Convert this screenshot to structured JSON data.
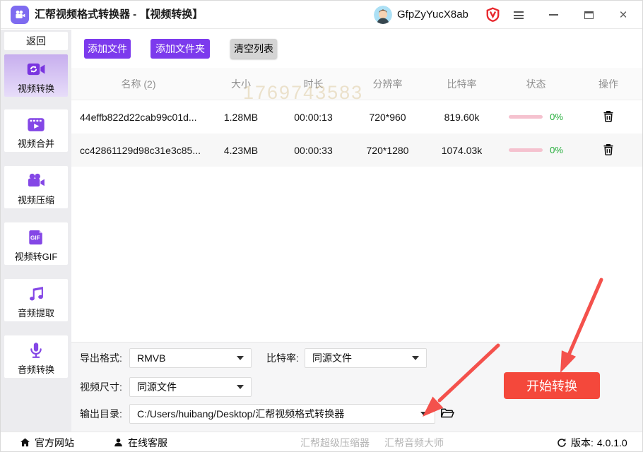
{
  "colors": {
    "accent_purple": "#7c3aed",
    "danger_red": "#f4483b",
    "annotation_red": "#f4514c",
    "progress_pink": "#f5c2cf",
    "success_green": "#22ac38"
  },
  "title_bar": {
    "app_title": "汇帮视频格式转换器 - 【视频转换】",
    "username": "GfpZyYucX8ab"
  },
  "sidebar": {
    "back": "返回",
    "items": [
      {
        "label": "视频转换",
        "icon": "video-convert-icon",
        "active": true
      },
      {
        "label": "视频合并",
        "icon": "video-merge-icon",
        "active": false
      },
      {
        "label": "视频压缩",
        "icon": "video-compress-icon",
        "active": false
      },
      {
        "label": "视频转GIF",
        "icon": "video-to-gif-icon",
        "active": false
      },
      {
        "label": "音频提取",
        "icon": "audio-extract-icon",
        "active": false
      },
      {
        "label": "音频转换",
        "icon": "audio-convert-icon",
        "active": false
      }
    ]
  },
  "toolbar": {
    "add_file": "添加文件",
    "add_folder": "添加文件夹",
    "clear_list": "清空列表"
  },
  "table": {
    "headers": [
      "名称 (2)",
      "大小",
      "时长",
      "分辨率",
      "比特率",
      "状态",
      "操作"
    ],
    "watermark": "1769743583",
    "rows": [
      {
        "name": "44effb822d22cab99c01d...",
        "size": "1.28MB",
        "duration": "00:00:13",
        "resolution": "720*960",
        "bitrate": "819.60k",
        "progress": "0%"
      },
      {
        "name": "cc42861129d98c31e3c85...",
        "size": "4.23MB",
        "duration": "00:00:33",
        "resolution": "720*1280",
        "bitrate": "1074.03k",
        "progress": "0%"
      }
    ]
  },
  "settings": {
    "export_format": {
      "label": "导出格式:",
      "value": "RMVB"
    },
    "bitrate": {
      "label": "比特率:",
      "value": "同源文件"
    },
    "video_size": {
      "label": "视频尺寸:",
      "value": "同源文件"
    },
    "output_dir": {
      "label": "输出目录:",
      "value": "C:/Users/huibang/Desktop/汇帮视频格式转换器"
    },
    "start_button": "开始转换"
  },
  "footer": {
    "official_site": "官方网站",
    "online_service": "在线客服",
    "related_1": "汇帮超级压缩器",
    "related_2": "汇帮音频大师",
    "version_label": "版本:",
    "version_value": "4.0.1.0"
  }
}
